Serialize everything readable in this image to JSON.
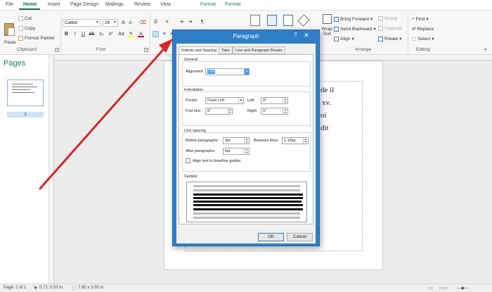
{
  "ribbon": {
    "tabs": [
      "File",
      "Home",
      "Insert",
      "Page Design",
      "Mailings",
      "Review",
      "View",
      "Format",
      "Format"
    ],
    "clipboard": {
      "paste": "Paste",
      "cut": "Cut",
      "copy": "Copy",
      "format_painter": "Format Painter",
      "label": "Clipboard"
    },
    "font": {
      "name": "Calibri",
      "size": "26",
      "label": "Font"
    },
    "arrange": {
      "bring_forward": "Bring Forward",
      "send_backward": "Send Backward",
      "align": "Align",
      "group": "Group",
      "ungroup": "Ungroup",
      "rotate": "Rotate",
      "label": "Arrange"
    },
    "wrap_text": "Wrap Text",
    "editing": {
      "find": "Find",
      "replace": "Replace",
      "select": "Select",
      "label": "Editing"
    }
  },
  "pages_pane": {
    "title": "Pages",
    "page_number": "1"
  },
  "document": {
    "text_lines": [
      "de il",
      "xv.",
      "oi",
      "dit"
    ]
  },
  "dialog": {
    "title": "Paragraph",
    "help": "?",
    "tabs": [
      "Indents and Spacing",
      "Tabs",
      "Line and Paragraph Breaks"
    ],
    "general": {
      "label": "General",
      "alignment_label": "Alignment:",
      "alignment_value": "Left"
    },
    "indentation": {
      "label": "Indentation",
      "preset_label": "Preset:",
      "preset_value": "Flush Left",
      "left_label": "Left:",
      "left_value": "0\"",
      "first_line_label": "First line:",
      "first_line_value": "0\"",
      "right_label": "Right:",
      "right_value": "0\""
    },
    "line_spacing": {
      "label": "Line spacing",
      "before_label": "Before paragraphs:",
      "before_value": "0pt",
      "between_label": "Between lines:",
      "between_value": "1.19sp",
      "after_label": "After paragraphs:",
      "after_value": "6pt",
      "align_baseline_label": "Align text to baseline guides",
      "align_baseline_checked": false
    },
    "sample_label": "Sample",
    "ok": "OK",
    "cancel": "Cancel"
  },
  "statusbar": {
    "page": "Page: 1 of 1",
    "position": "0.72, 0.53 in.",
    "size": "7.85 x 3.00 in."
  },
  "colors": {
    "accent": "#1a6b5a",
    "dialog_frame": "#2e7fc7",
    "arrow": "#d62626"
  }
}
